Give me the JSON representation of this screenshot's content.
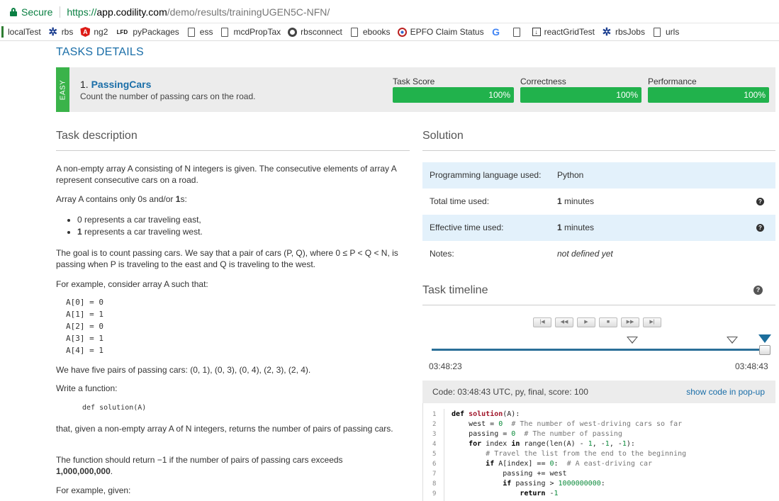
{
  "browser": {
    "secure_label": "Secure",
    "url_proto": "https://",
    "url_host": "app.codility.com",
    "url_path": "/demo/results/trainingUGEN5C-NFN/"
  },
  "bookmarks": [
    {
      "label": "localTest",
      "icon": "grip"
    },
    {
      "label": "rbs",
      "icon": "star-icon"
    },
    {
      "label": "ng2",
      "icon": "angular-icon"
    },
    {
      "label": "pyPackages",
      "icon": "lfd-icon"
    },
    {
      "label": "ess",
      "icon": "page-icon"
    },
    {
      "label": "mcdPropTax",
      "icon": "page-icon"
    },
    {
      "label": "rbsconnect",
      "icon": "circle-icon"
    },
    {
      "label": "ebooks",
      "icon": "page-icon"
    },
    {
      "label": "EPFO Claim Status",
      "icon": "epfo-icon"
    },
    {
      "label": "",
      "icon": "google-icon"
    },
    {
      "label": "",
      "icon": "page-icon"
    },
    {
      "label": "reactGridTest",
      "icon": "download-icon"
    },
    {
      "label": "rbsJobs",
      "icon": "star-icon"
    },
    {
      "label": "urls",
      "icon": "page-icon"
    }
  ],
  "page": {
    "section_title": "TASKS DETAILS",
    "difficulty": "EASY",
    "task_number": "1.",
    "task_name": "PassingCars",
    "task_desc": "Count the number of passing cars on the road.",
    "metrics": [
      {
        "label": "Task Score",
        "value": "100%"
      },
      {
        "label": "Correctness",
        "value": "100%"
      },
      {
        "label": "Performance",
        "value": "100%"
      }
    ]
  },
  "description": {
    "heading": "Task description",
    "p1": "A non-empty array A consisting of N integers is given. The consecutive elements of array A represent consecutive cars on a road.",
    "p2_pre": "Array A contains only 0s and/or ",
    "p2_bold": "1",
    "p2_post": "s:",
    "bullet1": "0 represents a car traveling east,",
    "bullet2_bold": "1",
    "bullet2_rest": " represents a car traveling west.",
    "p3": "The goal is to count passing cars. We say that a pair of cars (P, Q), where 0 ≤ P < Q < N, is passing when P is traveling to the east and Q is traveling to the west.",
    "p4": "For example, consider array A such that:",
    "array_example": "A[0] = 0\nA[1] = 1\nA[2] = 0\nA[3] = 1\nA[4] = 1",
    "p5": "We have five pairs of passing cars: (0, 1), (0, 3), (0, 4), (2, 3), (2, 4).",
    "p6": "Write a function:",
    "signature": "def solution(A)",
    "p7": "that, given a non-empty array A of N integers, returns the number of pairs of passing cars.",
    "p8_pre": "The function should return −1 if the number of pairs of passing cars exceeds ",
    "p8_bold": "1,000,000,000",
    "p8_post": ".",
    "p9": "For example, given:"
  },
  "solution": {
    "heading": "Solution",
    "rows": [
      {
        "key": "Programming language used:",
        "value": "Python",
        "help": false
      },
      {
        "key": "Total time used:",
        "value_bold": "1",
        "value_rest": " minutes",
        "help": true
      },
      {
        "key": "Effective time used:",
        "value_bold": "1",
        "value_rest": " minutes",
        "help": true
      },
      {
        "key": "Notes:",
        "value": "not defined yet",
        "help": false
      }
    ]
  },
  "timeline": {
    "heading": "Task timeline",
    "start_time": "03:48:23",
    "end_time": "03:48:43",
    "buttons": [
      "|◀",
      "◀◀",
      "▶",
      "■",
      "▶▶",
      "▶|"
    ]
  },
  "code": {
    "header": "Code: 03:48:43 UTC, py, final, score:  100",
    "popup_link": "show code in pop-up",
    "line_numbers": [
      "1",
      "2",
      "3",
      "4",
      "5",
      "6",
      "7",
      "8",
      "9"
    ]
  },
  "colors": {
    "accent": "#1a6ea8",
    "success": "#21b24c",
    "easy": "#3ab34a"
  }
}
